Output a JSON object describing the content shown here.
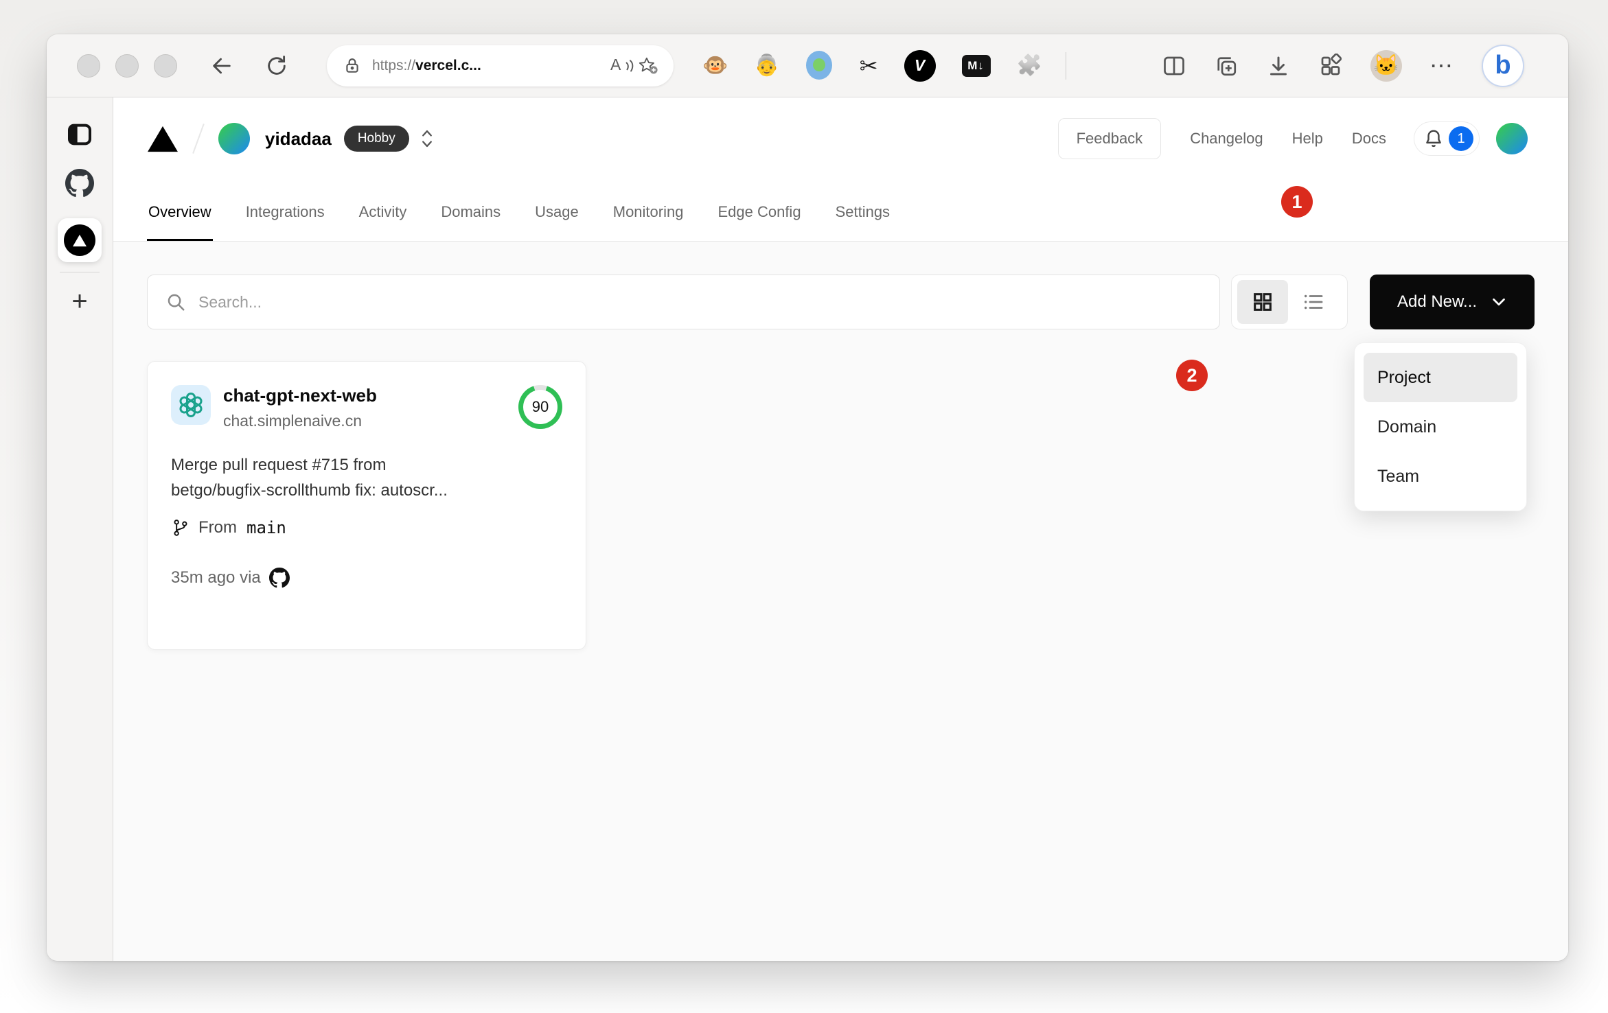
{
  "colors": {
    "accent_blue": "#0b6cf0",
    "annotation_red": "#da2b1d",
    "score_green": "#2fbf55",
    "brand_black": "#000000"
  },
  "browser": {
    "url": {
      "scheme": "https://",
      "host": "vercel.c..."
    },
    "icons": {
      "read_aloud_glyph": "A",
      "more_glyph": "⋯",
      "tampermonkey_glyph": "🐵",
      "translate_person_glyph": "👵",
      "scissors_glyph": "✂",
      "puzzle_glyph": "🧩",
      "cat_glyph": "🐱",
      "bing_glyph": "b",
      "v_ext_label": "V",
      "markdown_ext_label": "M↓",
      "new_tab_glyph": "+"
    },
    "translate_badge": "2"
  },
  "vercel": {
    "scope": {
      "name": "yidadaa",
      "plan": "Hobby"
    },
    "header": {
      "feedback": "Feedback",
      "links": [
        "Changelog",
        "Help",
        "Docs"
      ],
      "notification_count": "1"
    },
    "tabs": [
      "Overview",
      "Integrations",
      "Activity",
      "Domains",
      "Usage",
      "Monitoring",
      "Edge Config",
      "Settings"
    ],
    "toolbar": {
      "search_placeholder": "Search...",
      "add_new_label": "Add New..."
    },
    "menu": {
      "items": [
        "Project",
        "Domain",
        "Team"
      ]
    },
    "card": {
      "name": "chat-gpt-next-web",
      "domain": "chat.simplenaive.cn",
      "score": "90",
      "commit_line1": "Merge pull request #715 from",
      "commit_line2": "betgo/bugfix-scrollthumb fix: autoscr...",
      "from_label": "From",
      "branch": "main",
      "meta": "35m ago via"
    },
    "annotations": {
      "step1": "1",
      "step2": "2"
    }
  }
}
